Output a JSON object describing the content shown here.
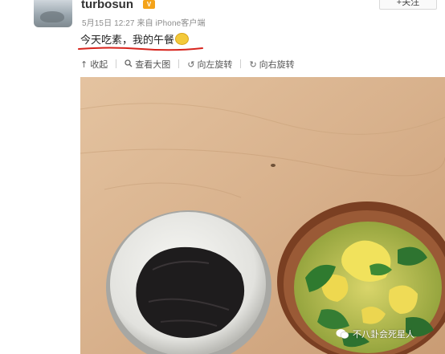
{
  "post": {
    "username": "turbosun",
    "vip_badge": "V",
    "follow_label": "+关注",
    "meta": "5月15日 12:27 来自 iPhone客户端",
    "text": "今天吃素，我的午餐"
  },
  "toolbar": {
    "items": [
      {
        "icon": "collapse-icon",
        "glyph": "↑",
        "label": "收起"
      },
      {
        "icon": "zoom-icon",
        "glyph": "🔍",
        "label": "查看大图"
      },
      {
        "icon": "rotate-left-icon",
        "glyph": "↺",
        "label": "向左旋转"
      },
      {
        "icon": "rotate-right-icon",
        "glyph": "↻",
        "label": "向右旋转"
      }
    ]
  },
  "watermark": {
    "text": "不八卦会死星人"
  },
  "colors": {
    "accent_underline": "#d7241d",
    "wood": "#d9b48f",
    "vip": "#f4a31a"
  }
}
